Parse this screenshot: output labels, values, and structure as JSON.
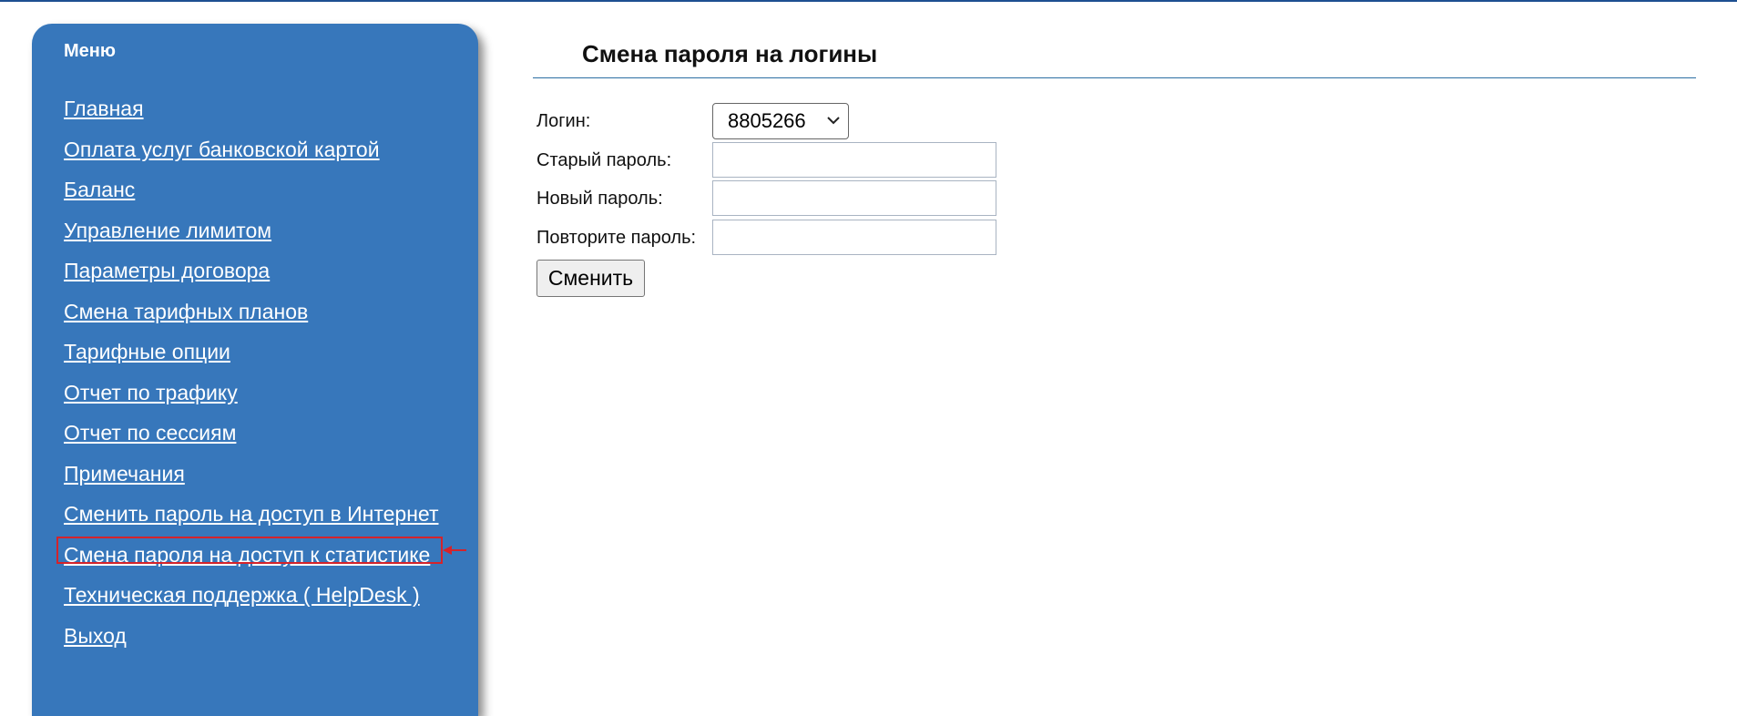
{
  "sidebar": {
    "title": "Меню",
    "items": [
      {
        "label": "Главная"
      },
      {
        "label": "Оплата услуг банковской картой"
      },
      {
        "label": "Баланс"
      },
      {
        "label": "Управление лимитом"
      },
      {
        "label": "Параметры договора"
      },
      {
        "label": "Смена тарифных планов"
      },
      {
        "label": "Тарифные опции"
      },
      {
        "label": "Отчет по трафику"
      },
      {
        "label": "Отчет по сессиям"
      },
      {
        "label": "Примечания"
      },
      {
        "label": "Сменить пароль на доступ в Интернет"
      },
      {
        "label": "Смена пароля на доступ к статистике"
      },
      {
        "label": "Техническая поддержка ( HelpDesk )"
      },
      {
        "label": "Выход"
      }
    ],
    "highlighted_item": "Смена пароля на доступ к статистике"
  },
  "main": {
    "title": "Смена пароля на логины",
    "form": {
      "login_label": "Логин:",
      "login_value": "8805266",
      "old_password_label": "Старый пароль:",
      "old_password_value": "",
      "new_password_label": "Новый пароль:",
      "new_password_value": "",
      "repeat_password_label": "Повторите пароль:",
      "repeat_password_value": "",
      "submit_label": "Сменить"
    }
  },
  "colors": {
    "sidebar_bg": "#3777bb",
    "top_border": "#1d4f91",
    "title_rule": "#2c6ea3",
    "annotation": "#d4232b"
  },
  "icons": {
    "select_chevron": "chevron-down-icon",
    "annotation_arrow": "arrow-left-icon"
  }
}
